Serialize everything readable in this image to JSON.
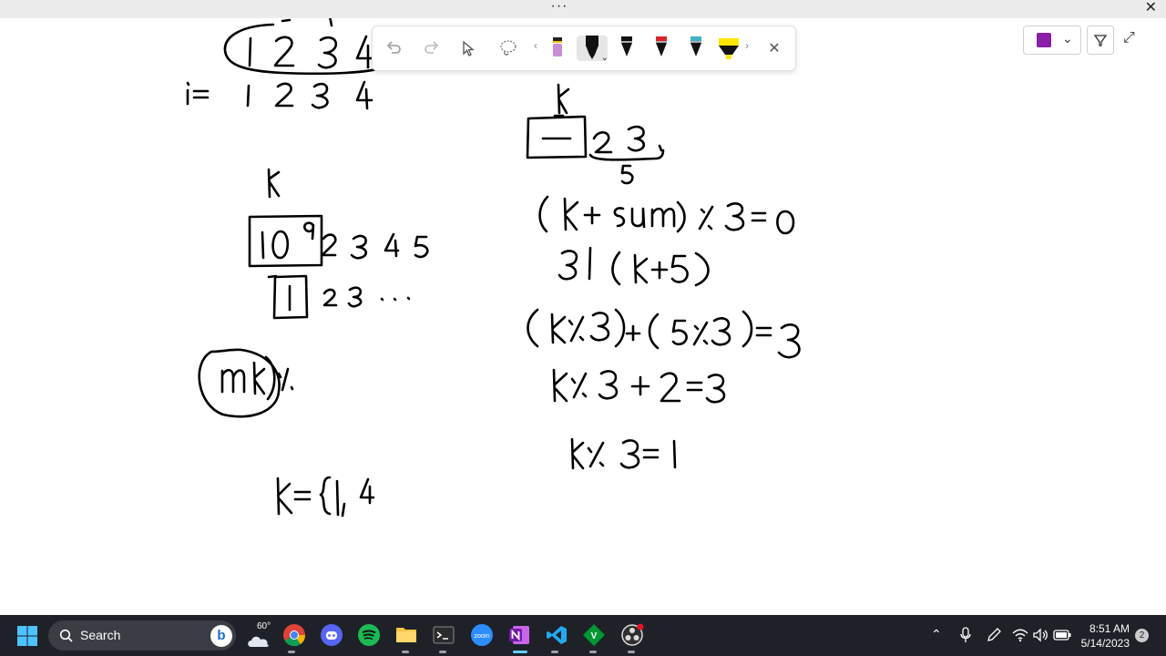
{
  "window": {
    "menu_glyph": "···",
    "close_glyph": "✕"
  },
  "drawing_toolbar": {
    "tools": [
      {
        "name": "undo-icon",
        "interactable": true
      },
      {
        "name": "redo-icon",
        "interactable": true
      },
      {
        "name": "select-icon",
        "interactable": true
      },
      {
        "name": "lasso-icon",
        "interactable": true
      },
      {
        "name": "eraser-pen",
        "color": "#c88fd8"
      },
      {
        "name": "black-pen-selected",
        "color": "#111111"
      },
      {
        "name": "black-pen-2",
        "color": "#111111"
      },
      {
        "name": "red-pen",
        "color": "#d7262b"
      },
      {
        "name": "galaxy-pen",
        "color": "#3fb3c8"
      },
      {
        "name": "yellow-highlighter",
        "color": "#ffe600"
      }
    ],
    "left_arrow": "‹",
    "right_arrow": "›",
    "dropdown_glyph": "⌄",
    "close_glyph": "✕"
  },
  "right_controls": {
    "notebook_color": "#8a1fa8",
    "expand_glyph": "⤢"
  },
  "taskbar": {
    "search_label": "Search",
    "bing_label": "b",
    "weather_temp": "60°",
    "pinned_apps": [
      "chrome",
      "discord",
      "spotify",
      "file-explorer",
      "terminal",
      "zoom",
      "onenote",
      "vscode",
      "vim",
      "obs"
    ],
    "clock_time": "8:51 AM",
    "clock_date": "5/14/2023",
    "notification_count": "2"
  }
}
